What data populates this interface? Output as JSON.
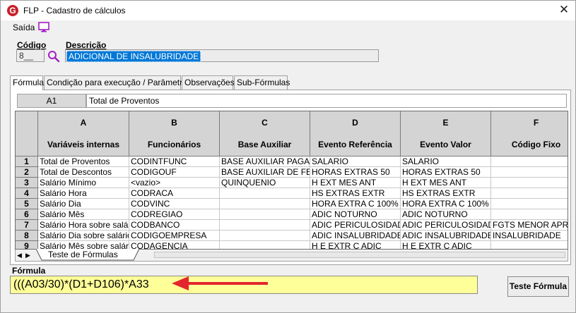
{
  "window": {
    "title": "FLP - Cadastro de cálculos",
    "logo_letter": "G",
    "close_glyph": "✕"
  },
  "toolbar": {
    "exit_label": "Saída",
    "exit_icon": "monitor-icon"
  },
  "fields": {
    "code_label": "Código",
    "code_value": "8",
    "desc_label": "Descrição",
    "desc_value": "ADICIONAL DE INSALUBRIDADE"
  },
  "tabs": [
    {
      "label": "Fórmula",
      "active": true
    },
    {
      "label": "Condição para execução / Parâmetros",
      "active": false
    },
    {
      "label": "Observações",
      "active": false
    },
    {
      "label": "Sub-Fórmulas",
      "active": false
    }
  ],
  "sheet": {
    "cell_ref": "A1",
    "cell_value": "Total de Proventos",
    "columns": [
      {
        "letter": "A",
        "name": "Variáveis internas"
      },
      {
        "letter": "B",
        "name": "Funcionários"
      },
      {
        "letter": "C",
        "name": "Base Auxiliar"
      },
      {
        "letter": "D",
        "name": "Evento Referência"
      },
      {
        "letter": "E",
        "name": "Evento Valor"
      },
      {
        "letter": "F",
        "name": "Código Fixo"
      }
    ],
    "rows": [
      {
        "num": "1",
        "cells": [
          "Total de Proventos",
          "CODINTFUNC",
          "BASE AUXILIAR PAGAMENTO",
          "SALARIO",
          "SALARIO",
          ""
        ]
      },
      {
        "num": "2",
        "cells": [
          "Total de Descontos",
          "CODIGOUF",
          "BASE AUXILIAR DE FERIAS",
          "HORAS EXTRAS 50",
          "HORAS EXTRAS 50",
          ""
        ]
      },
      {
        "num": "3",
        "cells": [
          "Salário Mínimo",
          "<vazio>",
          "QUINQUENIO",
          "H EXT MES ANT",
          "H EXT MES ANT",
          ""
        ]
      },
      {
        "num": "4",
        "cells": [
          "Salário Hora",
          "CODRACA",
          "",
          "HS EXTRAS EXTR",
          "HS EXTRAS EXTR",
          ""
        ]
      },
      {
        "num": "5",
        "cells": [
          "Salário Dia",
          "CODVINC",
          "",
          "HORA EXTRA C 100%",
          "HORA EXTRA C 100%",
          ""
        ]
      },
      {
        "num": "6",
        "cells": [
          "Salário Mês",
          "CODREGIAO",
          "",
          "ADIC NOTURNO",
          "ADIC NOTURNO",
          ""
        ]
      },
      {
        "num": "7",
        "cells": [
          "Salário Hora sobre salário",
          "CODBANCO",
          "",
          "ADIC PERICULOSIDADE",
          "ADIC PERICULOSIDADE",
          "FGTS MENOR APRENDIZ"
        ]
      },
      {
        "num": "8",
        "cells": [
          "Salário Dia sobre salário",
          "CODIGOEMPRESA",
          "",
          "ADIC INSALUBRIDADE",
          "ADIC INSALUBRIDADE",
          "INSALUBRIDADE"
        ]
      },
      {
        "num": "9",
        "cells": [
          "Salário Mês sobre salário",
          "CODAGENCIA",
          "",
          "H E EXTR C ADIC",
          "H E EXTR C ADIC",
          ""
        ]
      }
    ],
    "sheet_tab": "Teste de Fórmulas"
  },
  "formula": {
    "label": "Fórmula",
    "value": "(((A03/30)*(D1+D106)*A33",
    "test_button": "Teste Fórmula"
  },
  "colors": {
    "formula_bg": "#ffff99",
    "selection": "#0078d7",
    "arrow": "#e3262d",
    "header_bg": "#d4d4d4"
  }
}
